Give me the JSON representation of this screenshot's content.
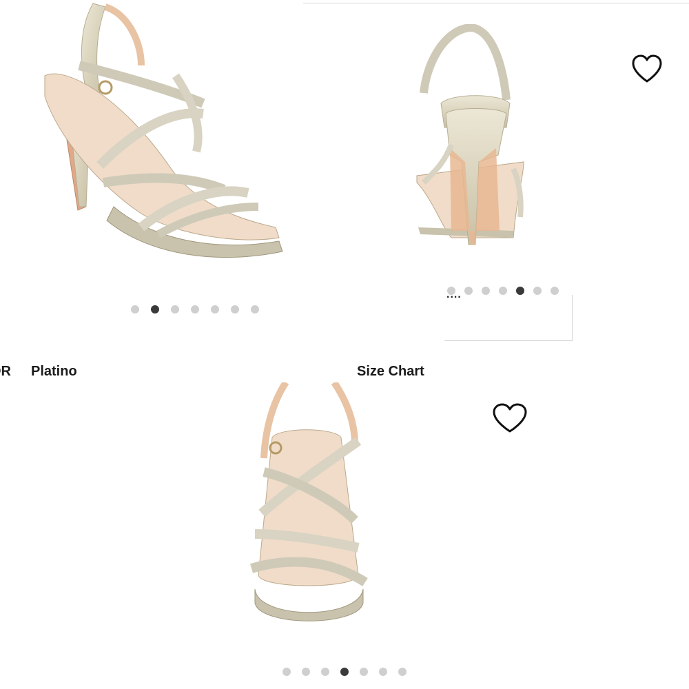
{
  "top_gallery": {
    "image_alt": "Sandal, side view",
    "dots_count": 7,
    "active_dot": 1
  },
  "right_gallery": {
    "image_alt": "Sandal, back view",
    "dots_count": 7,
    "active_dot": 4,
    "favorite_icon": "heart-outline-icon"
  },
  "overlay_fragment": {
    "text": "...."
  },
  "product": {
    "color_label": "OR",
    "color_value": "Platino",
    "size_chart_label": "Size Chart"
  },
  "bottom_gallery": {
    "image_alt": "Sandal, front view",
    "dots_count": 7,
    "active_dot": 3,
    "favorite_icon": "heart-outline-icon"
  },
  "colors": {
    "dot_inactive": "#cfcfcf",
    "dot_active": "#3a3a3a",
    "text": "#1b1b1b",
    "glitter": "#d9d3bf",
    "sole": "#e8c3a4"
  }
}
